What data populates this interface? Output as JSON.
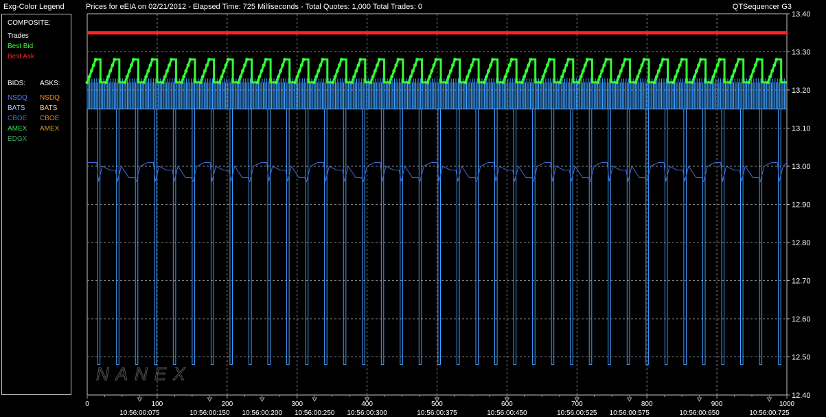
{
  "header": {
    "legend_title": "Exg-Color Legend",
    "chart_title": "Prices for  eEIA  on  02/21/2012  -  Elapsed Time: 725 Milliseconds  -  Total Quotes: 1,000  Total Trades: 0",
    "app_name": "QTSequencer G3"
  },
  "legend": {
    "composite_label": "COMPOSITE:",
    "composite_items": [
      {
        "label": "Trades",
        "color": "#ffffff"
      },
      {
        "label": "Best Bid",
        "color": "#33ff33"
      },
      {
        "label": "Best Ask",
        "color": "#ff2222"
      }
    ],
    "bids_label": "BIDS:",
    "asks_label": "ASKS:",
    "bids": [
      {
        "label": "NSDQ",
        "color": "#4f86ff"
      },
      {
        "label": "BATS",
        "color": "#a8c8ff"
      },
      {
        "label": "CBOE",
        "color": "#3f6ad8"
      },
      {
        "label": "AMEX",
        "color": "#33dd55"
      },
      {
        "label": "EDGX",
        "color": "#3fa060"
      }
    ],
    "asks": [
      {
        "label": "NSDQ",
        "color": "#ff8c1a"
      },
      {
        "label": "BATS",
        "color": "#ffcc77"
      },
      {
        "label": "CBOE",
        "color": "#c08040"
      },
      {
        "label": "AMEX",
        "color": "#d0a020"
      }
    ]
  },
  "watermark": "NANEX",
  "chart_data": {
    "type": "line",
    "xlim": [
      0,
      1000
    ],
    "ylim": [
      12.4,
      13.4
    ],
    "x_ticks": [
      0,
      100,
      200,
      300,
      400,
      500,
      600,
      700,
      800,
      900,
      1000
    ],
    "y_ticks": [
      "12.40",
      "12.50",
      "12.60",
      "12.70",
      "12.80",
      "12.90",
      "13.00",
      "13.10",
      "13.20",
      "13.30",
      "13.40"
    ],
    "time_labels": [
      {
        "x": 75,
        "label": "10:56:00:075"
      },
      {
        "x": 175,
        "label": "10:56:00:150"
      },
      {
        "x": 250,
        "label": "10:56:00:200"
      },
      {
        "x": 325,
        "label": "10:56:00:250"
      },
      {
        "x": 400,
        "label": "10:56:00:300"
      },
      {
        "x": 500,
        "label": "10:56:00:375"
      },
      {
        "x": 600,
        "label": "10:56:00:450"
      },
      {
        "x": 700,
        "label": "10:56:00:525"
      },
      {
        "x": 775,
        "label": "10:56:00:575"
      },
      {
        "x": 875,
        "label": "10:56:00:650"
      },
      {
        "x": 975,
        "label": "10:56:00:725"
      }
    ],
    "grid": true,
    "series": [
      {
        "name": "Best Ask",
        "color": "#ff2222",
        "values": [
          13.35
        ]
      },
      {
        "name": "Best Bid",
        "color": "#33ff33",
        "range": [
          13.22,
          13.28
        ]
      },
      {
        "name": "NSDQ",
        "color": "#3fa0ff",
        "range": [
          12.48,
          13.23
        ]
      },
      {
        "name": "CBOE",
        "color": "#3f6ad8",
        "range": [
          12.96,
          13.01
        ]
      }
    ],
    "cycles": 37
  }
}
